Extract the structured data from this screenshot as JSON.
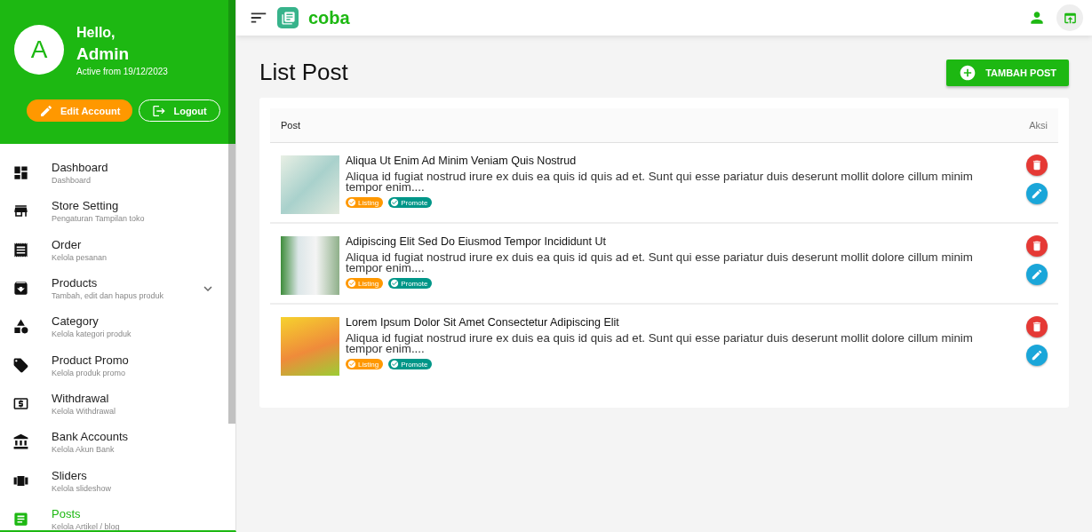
{
  "profile": {
    "avatar_letter": "A",
    "greeting": "Hello,",
    "name": "Admin",
    "active_since": "Active from 19/12/2023",
    "buttons": [
      {
        "kind": "edit",
        "label": "Edit Account"
      },
      {
        "kind": "logout",
        "label": "Logout"
      }
    ]
  },
  "menu": [
    {
      "title": "Dashboard",
      "subtitle": "Dashboard",
      "selected": false
    },
    {
      "title": "Store Setting",
      "subtitle": "Pengaturan Tampilan toko",
      "selected": false
    },
    {
      "title": "Order",
      "subtitle": "Kelola pesanan",
      "selected": false
    },
    {
      "title": "Products",
      "subtitle": "Tambah, edit dan hapus produk",
      "selected": false,
      "expanded": false
    },
    {
      "title": "Category",
      "subtitle": "Kelola kategori produk",
      "selected": false
    },
    {
      "title": "Product Promo",
      "subtitle": "Kelola produk promo",
      "selected": false
    },
    {
      "title": "Withdrawal",
      "subtitle": "Kelola Withdrawal",
      "selected": false
    },
    {
      "title": "Bank Accounts",
      "subtitle": "Kelola Akun Bank",
      "selected": false
    },
    {
      "title": "Sliders",
      "subtitle": "Kelola slideshow",
      "selected": false
    },
    {
      "title": "Posts",
      "subtitle": "Kelola Artikel / blog",
      "selected": true
    }
  ],
  "topbar": {
    "app_name": "coba"
  },
  "page": {
    "title": "List Post",
    "add_button": "TAMBAH POST"
  },
  "table": {
    "columns": [
      "Post",
      "Aksi"
    ],
    "rows": [
      {
        "title": "Aliqua Ut Enim Ad Minim Veniam Quis Nostrud",
        "excerpt": "Aliqua id fugiat nostrud irure ex duis ea quis id quis ad et. Sunt qui esse pariatur duis deserunt mollit dolore cillum minim tempor enim....",
        "badges": [
          {
            "label": "Listing",
            "color": "#ff9800"
          },
          {
            "label": "Promote",
            "color": "#009688"
          }
        ]
      },
      {
        "title": "Adipiscing Elit Sed Do Eiusmod Tempor Incididunt Ut",
        "excerpt": "Aliqua id fugiat nostrud irure ex duis ea quis id quis ad et. Sunt qui esse pariatur duis deserunt mollit dolore cillum minim tempor enim....",
        "badges": [
          {
            "label": "Listing",
            "color": "#ff9800"
          },
          {
            "label": "Promote",
            "color": "#009688"
          }
        ]
      },
      {
        "title": "Lorem Ipsum Dolor Sit Amet Consectetur Adipiscing Elit",
        "excerpt": "Aliqua id fugiat nostrud irure ex duis ea quis id quis ad et. Sunt qui esse pariatur duis deserunt mollit dolore cillum minim tempor enim....",
        "badges": [
          {
            "label": "Listing",
            "color": "#ff9800"
          },
          {
            "label": "Promote",
            "color": "#009688"
          }
        ]
      }
    ]
  }
}
